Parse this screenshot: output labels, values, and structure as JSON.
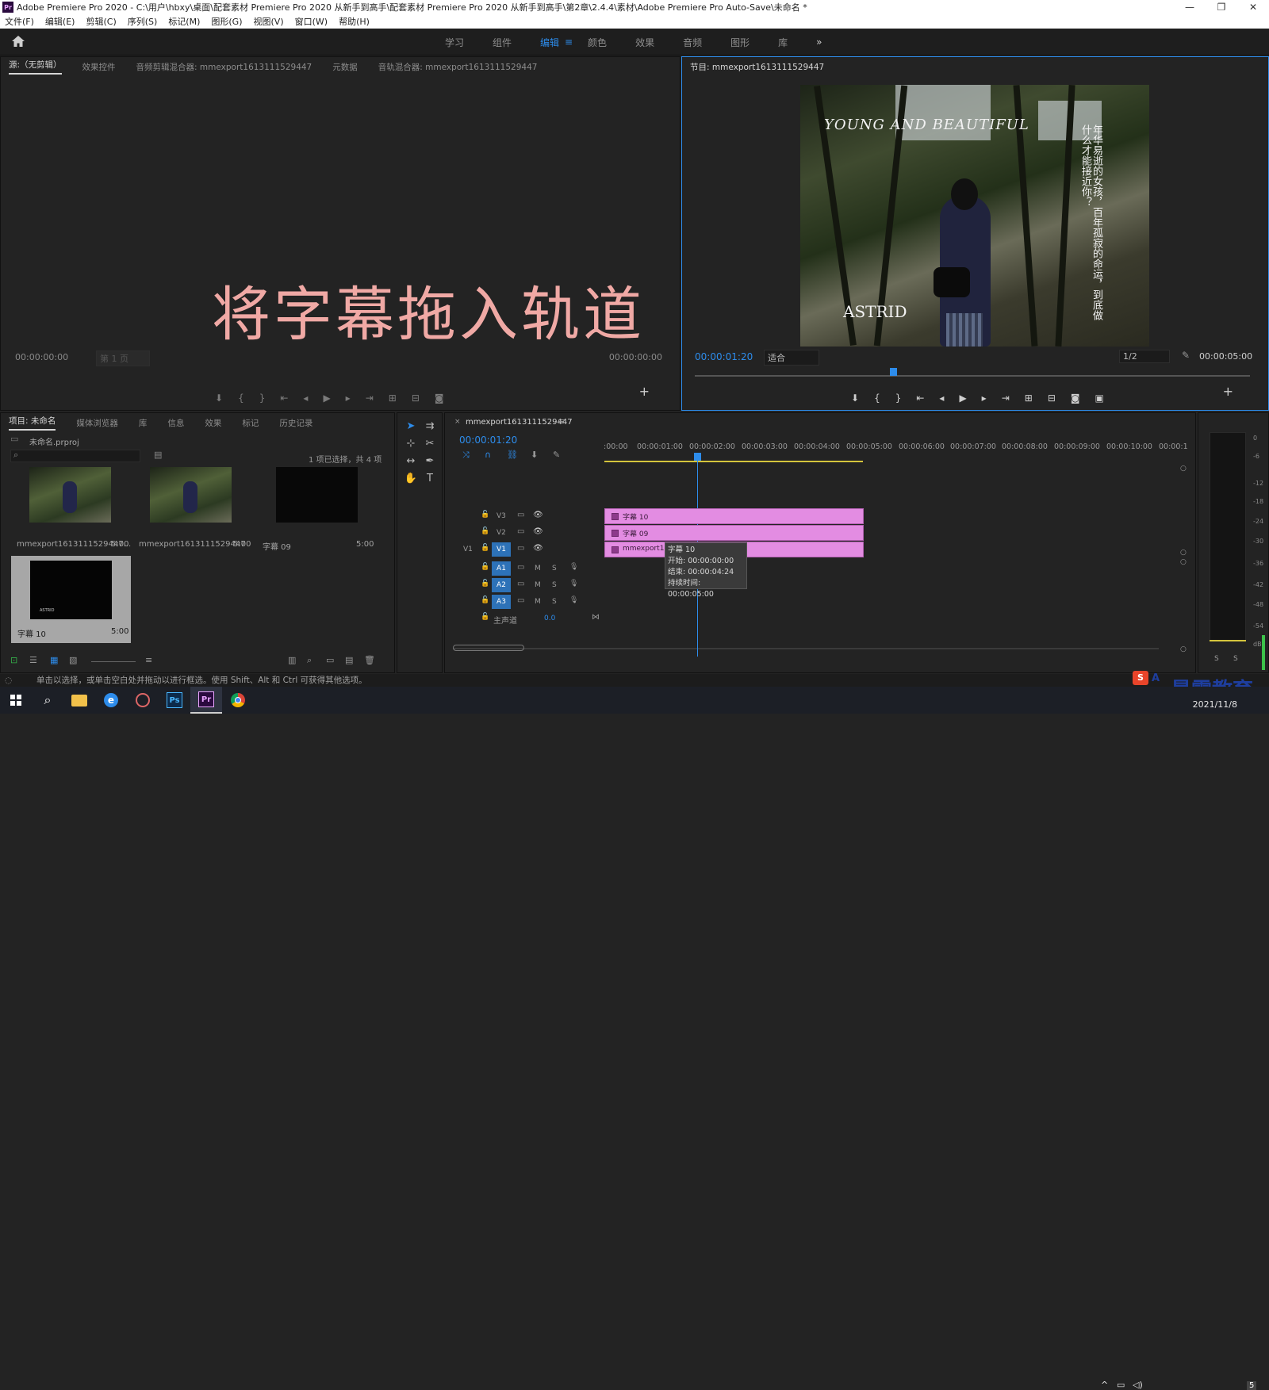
{
  "window": {
    "logo": "Pr",
    "title": "Adobe Premiere Pro 2020 - C:\\用户\\hbxy\\桌面\\配套素材 Premiere Pro 2020 从新手到高手\\配套素材 Premiere Pro 2020 从新手到高手\\第2章\\2.4.4\\素材\\Adobe Premiere Pro Auto-Save\\未命名 *",
    "controls": [
      "—",
      "❐",
      "✕"
    ]
  },
  "menu": [
    "文件(F)",
    "编辑(E)",
    "剪辑(C)",
    "序列(S)",
    "标记(M)",
    "图形(G)",
    "视图(V)",
    "窗口(W)",
    "帮助(H)"
  ],
  "workspaces": {
    "tabs": [
      "学习",
      "组件",
      "编辑",
      "颜色",
      "效果",
      "音频",
      "图形",
      "库"
    ],
    "active": "编辑",
    "more": "»"
  },
  "source_panel": {
    "tabs": [
      "源:（无剪辑）",
      "效果控件",
      "音频剪辑混合器: mmexport1613111529447",
      "元数据",
      "音轨混合器: mmexport1613111529447"
    ],
    "timecode_left": "00:00:00:00",
    "page_select": "第 1 页",
    "timecode_right": "00:00:00:00",
    "overlay_text": "将字幕拖入轨道"
  },
  "program_panel": {
    "tab": "节目: mmexport1613111529447",
    "timecode": "00:00:01:20",
    "fit": "适合",
    "resolution": "1/2",
    "duration": "00:00:05:00",
    "video_title": "YOUNG AND BEAUTIFUL",
    "video_vertical": "年华易逝的女孩，百年孤寂的命运，到底做什么才能接近你？",
    "video_name": "ASTRID"
  },
  "project_panel": {
    "tabs": [
      "项目: 未命名",
      "媒体浏览器",
      "库",
      "信息",
      "效果",
      "标记",
      "历史记录"
    ],
    "file": "未命名.prproj",
    "selection_info": "1 项已选择，共 4 项",
    "items": [
      {
        "name": "mmexport1613111529447...",
        "duration": "5:00"
      },
      {
        "name": "mmexport1613111529447",
        "duration": "5:00"
      },
      {
        "name": "字幕 09",
        "duration": "5:00"
      },
      {
        "name": "字幕 10",
        "duration": "5:00"
      }
    ],
    "thumb_caption_astrid": "ASTRID"
  },
  "timeline": {
    "tab": "mmexport1613111529447",
    "timecode": "00:00:01:20",
    "ruler": [
      ":00:00",
      "00:00:01:00",
      "00:00:02:00",
      "00:00:03:00",
      "00:00:04:00",
      "00:00:05:00",
      "00:00:06:00",
      "00:00:07:00",
      "00:00:08:00",
      "00:00:09:00",
      "00:00:10:00",
      "00:00:1"
    ],
    "tracks": {
      "video": [
        "V3",
        "V2",
        "V1"
      ],
      "audio": [
        "A1",
        "A2",
        "A3"
      ],
      "v1_source": "V1",
      "mute": "M",
      "solo": "S",
      "master_label": "主声道",
      "master_value": "0.0"
    },
    "clips": {
      "v3": "字幕 10",
      "v2": "字幕 09",
      "v1": "mmexport1613"
    },
    "tooltip": {
      "name": "字幕 10",
      "start": "开始: 00:00:00:00",
      "end": "结束: 00:00:04:24",
      "duration": "持续时间: 00:00:05:00"
    }
  },
  "audio_meter": {
    "ticks": [
      "0",
      "-6",
      "-12",
      "-18",
      "-24",
      "-30",
      "-36",
      "-42",
      "-48",
      "-54",
      "dB"
    ],
    "solo_buttons": [
      "S",
      "S"
    ]
  },
  "status_bar": "单击以选择，或单击空白处并拖动以进行框选。使用 Shift、Alt 和 Ctrl 可获得其他选项。",
  "taskbar": {
    "date": "2021/11/8",
    "ime": "A",
    "ps_label": "Ps",
    "pr_label": "Pr",
    "notif_count": "5"
  },
  "watermark": "最需教育"
}
